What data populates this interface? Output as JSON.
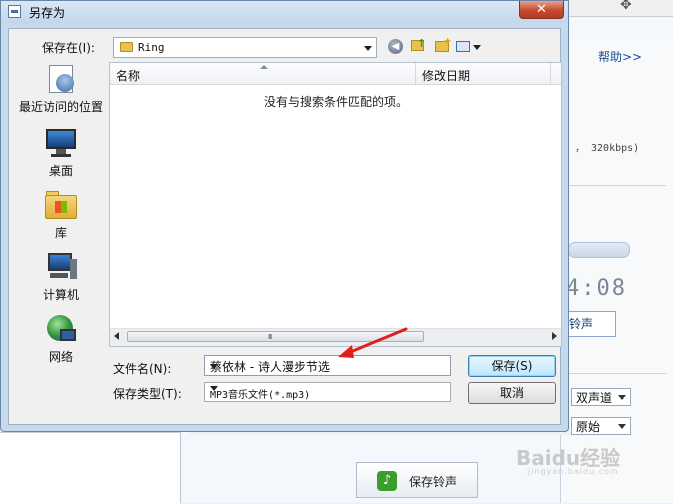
{
  "dialog": {
    "title": "另存为",
    "close_glyph": "✕"
  },
  "toolbar": {
    "save_in_label": "保存在(I):",
    "current_folder": "Ring"
  },
  "places": [
    {
      "label": "最近访问的位置",
      "icon": "recent-places-icon"
    },
    {
      "label": "桌面",
      "icon": "desktop-icon"
    },
    {
      "label": "库",
      "icon": "libraries-icon"
    },
    {
      "label": "计算机",
      "icon": "computer-icon"
    },
    {
      "label": "网络",
      "icon": "network-icon"
    }
  ],
  "file_list": {
    "columns": [
      "名称",
      "修改日期"
    ],
    "empty_message": "没有与搜索条件匹配的项。",
    "scroll_grip": "III"
  },
  "form": {
    "filename_label": "文件名(N):",
    "filename_value": "蔡依林 - 诗人漫步节选",
    "filetype_label": "保存类型(T):",
    "filetype_value": "MP3音乐文件(*.mp3)"
  },
  "buttons": {
    "save": "保存(S)",
    "cancel": "取消"
  },
  "background_app": {
    "help_link": "帮助>>",
    "bitrate_text": "，  320kbps)",
    "time_display": "4:08",
    "ringtone_button": "铃声",
    "channel_select": "双声道",
    "quality_select": "原始",
    "save_ringtone_button": "保存铃声"
  },
  "watermark": {
    "brand": "Baidu经验",
    "url": "jingyan.baidu.com"
  },
  "colors": {
    "annotation_arrow": "#e0201c",
    "save_ringtone_icon": "#3a9d2c"
  }
}
